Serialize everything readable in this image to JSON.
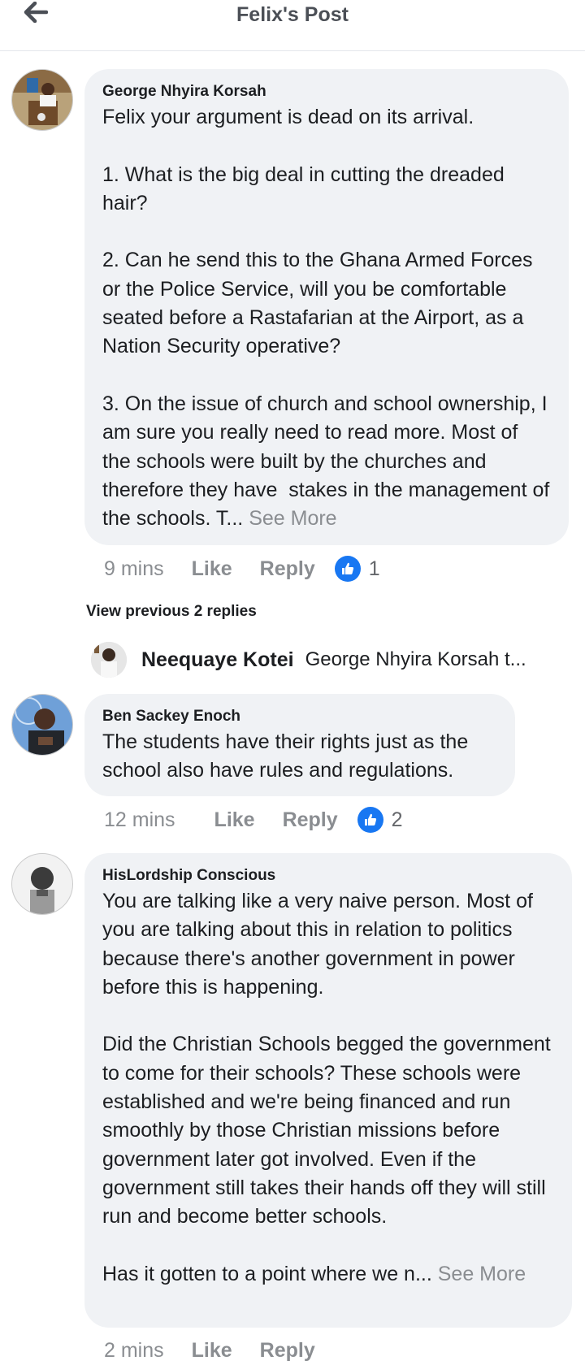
{
  "header": {
    "title": "Felix's Post",
    "back_icon": "arrow-left-icon"
  },
  "comments": [
    {
      "author": "George Nhyira Korsah",
      "paragraphs": [
        "Felix your argument is dead on its arrival.",
        "1. What is the big deal in cutting the dreaded hair?",
        "2. Can he send this to the Ghana Armed Forces or the Police Service, will you be comfortable seated before a Rastafarian at the Airport, as a Nation Security operative?",
        "3. On the issue of church and school ownership, I am sure you really need to read more. Most of the schools were built by the churches and therefore they have  stakes in the management of the schools. T..."
      ],
      "see_more": " See More",
      "time": "9 mins",
      "like_label": "Like",
      "reply_label": "Reply",
      "reaction_count": "1"
    },
    {
      "author": "Ben Sackey Enoch",
      "paragraphs": [
        "The students have their rights just as the school also have rules and regulations."
      ],
      "time": "12 mins",
      "like_label": "Like",
      "reply_label": "Reply",
      "reaction_count": "2"
    },
    {
      "author": "HisLordship Conscious",
      "paragraphs": [
        "You are talking like a very naive person. Most of you are talking about this in relation to politics because there's another government in power before this is happening.",
        "Did the Christian Schools begged the government to come for their schools? These schools were established and we're being financed and run smoothly by those Christian missions before government later got involved. Even if the government still takes their hands off they will still run and become better schools.",
        "Has it gotten to a point where we n..."
      ],
      "see_more": " See More",
      "time": "2 mins",
      "like_label": "Like",
      "reply_label": "Reply"
    }
  ],
  "replies": {
    "view_previous_label": "View previous 2 replies",
    "preview_name": "Neequaye Kotei",
    "preview_text": "George Nhyira Korsah t..."
  },
  "colors": {
    "bubble": "#f0f2f5",
    "like_blue": "#1877f2",
    "muted": "#8a8d91"
  }
}
